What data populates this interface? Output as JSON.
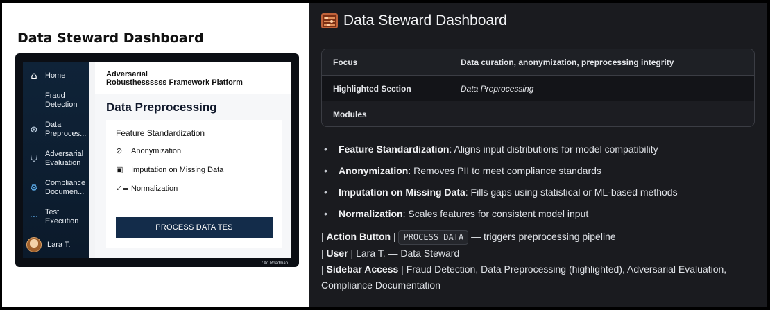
{
  "mockup": {
    "title": "Data Steward Dashboard",
    "sidebar": {
      "items": [
        {
          "label": "Home",
          "icon": "home-icon"
        },
        {
          "label": "Fraud\nDetection",
          "icon": "dash-icon"
        },
        {
          "label": "Data\nPreproces...",
          "icon": "brain-icon"
        },
        {
          "label": "Adversarial\nEvaluation",
          "icon": "shield-icon"
        },
        {
          "label": "Compliance\nDocumen...",
          "icon": "gear-icon"
        },
        {
          "label": "Test\nExecution",
          "icon": "ellipsis-icon"
        }
      ],
      "user": "Lara T."
    },
    "header": {
      "app_name": "Adversarial\nRobusthessssss Framework Platform"
    },
    "section_title": "Data Preprocessing",
    "card": {
      "title": "Feature Standardization",
      "rows": [
        {
          "label": "Anonymization",
          "icon": "eye-slash-icon"
        },
        {
          "label": "Imputation on Missing Data",
          "icon": "box-icon"
        },
        {
          "label": "Normalization",
          "icon": "checklist-icon"
        }
      ],
      "button": "PROCESS DATA TES"
    },
    "watermark": "/ Ad Roadmap"
  },
  "doc": {
    "title": "Data Steward Dashboard",
    "table": [
      {
        "key": "Focus",
        "value": "Data curation, anonymization, preprocessing integrity"
      },
      {
        "key": "Highlighted Section",
        "value": "Data Preprocessing"
      },
      {
        "key": "Modules",
        "value": ""
      }
    ],
    "bullets": [
      {
        "term": "Feature Standardization",
        "desc": ": Aligns input distributions for model compatibility"
      },
      {
        "term": "Anonymization",
        "desc": ": Removes PII to meet compliance standards"
      },
      {
        "term": "Imputation on Missing Data",
        "desc": ": Fills gaps using statistical or ML-based methods"
      },
      {
        "term": "Normalization",
        "desc": ": Scales features for consistent model input"
      }
    ],
    "action": {
      "prefix": "| ",
      "label": "Action Button",
      "sep": " | ",
      "code": "PROCESS DATA",
      "suffix": " — triggers preprocessing pipeline"
    },
    "user": {
      "prefix": "| ",
      "label": "User",
      "text": " | Lara T. — Data Steward"
    },
    "sidebar_access": {
      "prefix": "| ",
      "label": "Sidebar Access",
      "text": " | Fraud Detection, Data Preprocessing (highlighted), Adversarial Evaluation, Compliance Documentation"
    }
  }
}
